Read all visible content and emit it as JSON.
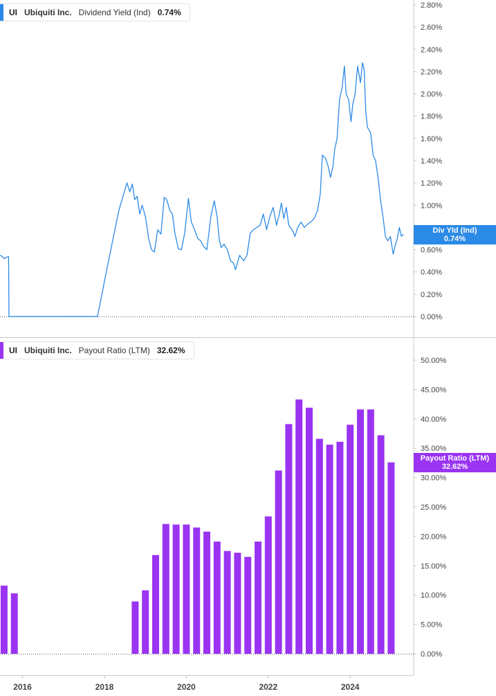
{
  "colors": {
    "yield": "#2b8ae6",
    "payout": "#9a34f2",
    "axis": "#c8c8c8"
  },
  "legends": [
    {
      "ticker": "UI",
      "name": "Ubiquiti Inc.",
      "series": "Dividend Yield (Ind)",
      "value": "0.74%"
    },
    {
      "ticker": "UI",
      "name": "Ubiquiti Inc.",
      "series": "Payout Ratio (LTM)",
      "value": "32.62%"
    }
  ],
  "tags": [
    {
      "label": "Div Yld (Ind)",
      "value": "0.74%"
    },
    {
      "label": "Payout Ratio (LTM)",
      "value": "32.62%"
    }
  ],
  "chart_data": [
    {
      "type": "line",
      "series": [
        {
          "name": "Dividend Yield (Ind)",
          "unit": "%"
        }
      ],
      "ylim": [
        0,
        2.8
      ],
      "yticks": [
        "0.00%",
        "0.20%",
        "0.40%",
        "0.60%",
        "0.80%",
        "1.00%",
        "1.20%",
        "1.40%",
        "1.60%",
        "1.80%",
        "2.00%",
        "2.20%",
        "2.40%",
        "2.60%",
        "2.80%"
      ],
      "points": [
        [
          2015.45,
          0.55
        ],
        [
          2015.5,
          0.54
        ],
        [
          2015.55,
          0.52
        ],
        [
          2015.6,
          0.53
        ],
        [
          2015.66,
          0.54
        ],
        [
          2015.67,
          0.0
        ],
        [
          2016.0,
          0.0
        ],
        [
          2016.5,
          0.0
        ],
        [
          2017.0,
          0.0
        ],
        [
          2017.5,
          0.0
        ],
        [
          2017.83,
          0.0
        ],
        [
          2018.1,
          0.5
        ],
        [
          2018.35,
          0.95
        ],
        [
          2018.55,
          1.2
        ],
        [
          2018.62,
          1.12
        ],
        [
          2018.68,
          1.19
        ],
        [
          2018.74,
          1.05
        ],
        [
          2018.8,
          1.08
        ],
        [
          2018.86,
          0.92
        ],
        [
          2018.92,
          1.0
        ],
        [
          2019.0,
          0.9
        ],
        [
          2019.08,
          0.7
        ],
        [
          2019.15,
          0.6
        ],
        [
          2019.22,
          0.58
        ],
        [
          2019.3,
          0.78
        ],
        [
          2019.38,
          0.74
        ],
        [
          2019.46,
          1.07
        ],
        [
          2019.52,
          1.05
        ],
        [
          2019.6,
          0.95
        ],
        [
          2019.66,
          0.92
        ],
        [
          2019.72,
          0.75
        ],
        [
          2019.8,
          0.61
        ],
        [
          2019.88,
          0.6
        ],
        [
          2019.96,
          0.75
        ],
        [
          2020.05,
          1.06
        ],
        [
          2020.12,
          0.85
        ],
        [
          2020.2,
          0.78
        ],
        [
          2020.28,
          0.7
        ],
        [
          2020.35,
          0.68
        ],
        [
          2020.42,
          0.63
        ],
        [
          2020.5,
          0.6
        ],
        [
          2020.6,
          0.9
        ],
        [
          2020.68,
          1.04
        ],
        [
          2020.75,
          0.9
        ],
        [
          2020.8,
          0.7
        ],
        [
          2020.85,
          0.62
        ],
        [
          2020.92,
          0.65
        ],
        [
          2021.0,
          0.6
        ],
        [
          2021.08,
          0.5
        ],
        [
          2021.15,
          0.48
        ],
        [
          2021.2,
          0.42
        ],
        [
          2021.3,
          0.55
        ],
        [
          2021.4,
          0.5
        ],
        [
          2021.48,
          0.55
        ],
        [
          2021.56,
          0.75
        ],
        [
          2021.64,
          0.78
        ],
        [
          2021.72,
          0.8
        ],
        [
          2021.8,
          0.82
        ],
        [
          2021.88,
          0.92
        ],
        [
          2021.96,
          0.78
        ],
        [
          2022.04,
          0.9
        ],
        [
          2022.12,
          0.98
        ],
        [
          2022.2,
          0.82
        ],
        [
          2022.27,
          0.92
        ],
        [
          2022.32,
          1.02
        ],
        [
          2022.38,
          0.88
        ],
        [
          2022.44,
          0.98
        ],
        [
          2022.5,
          0.82
        ],
        [
          2022.58,
          0.78
        ],
        [
          2022.65,
          0.72
        ],
        [
          2022.72,
          0.8
        ],
        [
          2022.8,
          0.85
        ],
        [
          2022.88,
          0.8
        ],
        [
          2022.96,
          0.83
        ],
        [
          2023.04,
          0.85
        ],
        [
          2023.12,
          0.88
        ],
        [
          2023.2,
          0.95
        ],
        [
          2023.27,
          1.1
        ],
        [
          2023.32,
          1.45
        ],
        [
          2023.4,
          1.42
        ],
        [
          2023.46,
          1.35
        ],
        [
          2023.52,
          1.25
        ],
        [
          2023.58,
          1.35
        ],
        [
          2023.62,
          1.5
        ],
        [
          2023.68,
          1.6
        ],
        [
          2023.74,
          1.95
        ],
        [
          2023.8,
          2.05
        ],
        [
          2023.86,
          2.25
        ],
        [
          2023.9,
          2.0
        ],
        [
          2023.96,
          1.95
        ],
        [
          2024.02,
          1.75
        ],
        [
          2024.06,
          1.9
        ],
        [
          2024.12,
          2.0
        ],
        [
          2024.18,
          2.25
        ],
        [
          2024.25,
          2.1
        ],
        [
          2024.3,
          2.28
        ],
        [
          2024.34,
          2.22
        ],
        [
          2024.38,
          1.85
        ],
        [
          2024.42,
          1.7
        ],
        [
          2024.5,
          1.65
        ],
        [
          2024.56,
          1.45
        ],
        [
          2024.62,
          1.4
        ],
        [
          2024.68,
          1.25
        ],
        [
          2024.74,
          1.05
        ],
        [
          2024.8,
          0.9
        ],
        [
          2024.86,
          0.72
        ],
        [
          2024.92,
          0.68
        ],
        [
          2024.98,
          0.72
        ],
        [
          2025.05,
          0.56
        ],
        [
          2025.1,
          0.64
        ],
        [
          2025.15,
          0.7
        ],
        [
          2025.2,
          0.8
        ],
        [
          2025.25,
          0.72
        ],
        [
          2025.3,
          0.74
        ]
      ]
    },
    {
      "type": "bar",
      "series": [
        {
          "name": "Payout Ratio (LTM)",
          "unit": "%"
        }
      ],
      "ylim": [
        0,
        50
      ],
      "yticks": [
        "0.00%",
        "5.00%",
        "10.00%",
        "15.00%",
        "20.00%",
        "25.00%",
        "30.00%",
        "35.00%",
        "40.00%",
        "45.00%",
        "50.00%"
      ],
      "bars": [
        [
          2015.55,
          11.6
        ],
        [
          2015.8,
          10.3
        ],
        [
          2018.75,
          8.9
        ],
        [
          2019.0,
          10.8
        ],
        [
          2019.25,
          16.8
        ],
        [
          2019.5,
          22.1
        ],
        [
          2019.75,
          22.0
        ],
        [
          2020.0,
          22.0
        ],
        [
          2020.25,
          21.5
        ],
        [
          2020.5,
          20.8
        ],
        [
          2020.75,
          19.1
        ],
        [
          2021.0,
          17.5
        ],
        [
          2021.25,
          17.2
        ],
        [
          2021.5,
          16.5
        ],
        [
          2021.75,
          19.1
        ],
        [
          2022.0,
          23.4
        ],
        [
          2022.25,
          31.2
        ],
        [
          2022.5,
          39.1
        ],
        [
          2022.75,
          43.3
        ],
        [
          2023.0,
          41.9
        ],
        [
          2023.25,
          36.6
        ],
        [
          2023.5,
          35.6
        ],
        [
          2023.75,
          36.1
        ],
        [
          2024.0,
          39.0
        ],
        [
          2024.25,
          41.6
        ],
        [
          2024.5,
          41.6
        ],
        [
          2024.75,
          37.2
        ],
        [
          2025.0,
          32.6
        ]
      ]
    }
  ],
  "xaxis": {
    "range": [
      2015.45,
      2025.55
    ],
    "ticks": [
      2016,
      2018,
      2020,
      2022,
      2024
    ],
    "labels": [
      "2016",
      "2018",
      "2020",
      "2022",
      "2024"
    ]
  }
}
